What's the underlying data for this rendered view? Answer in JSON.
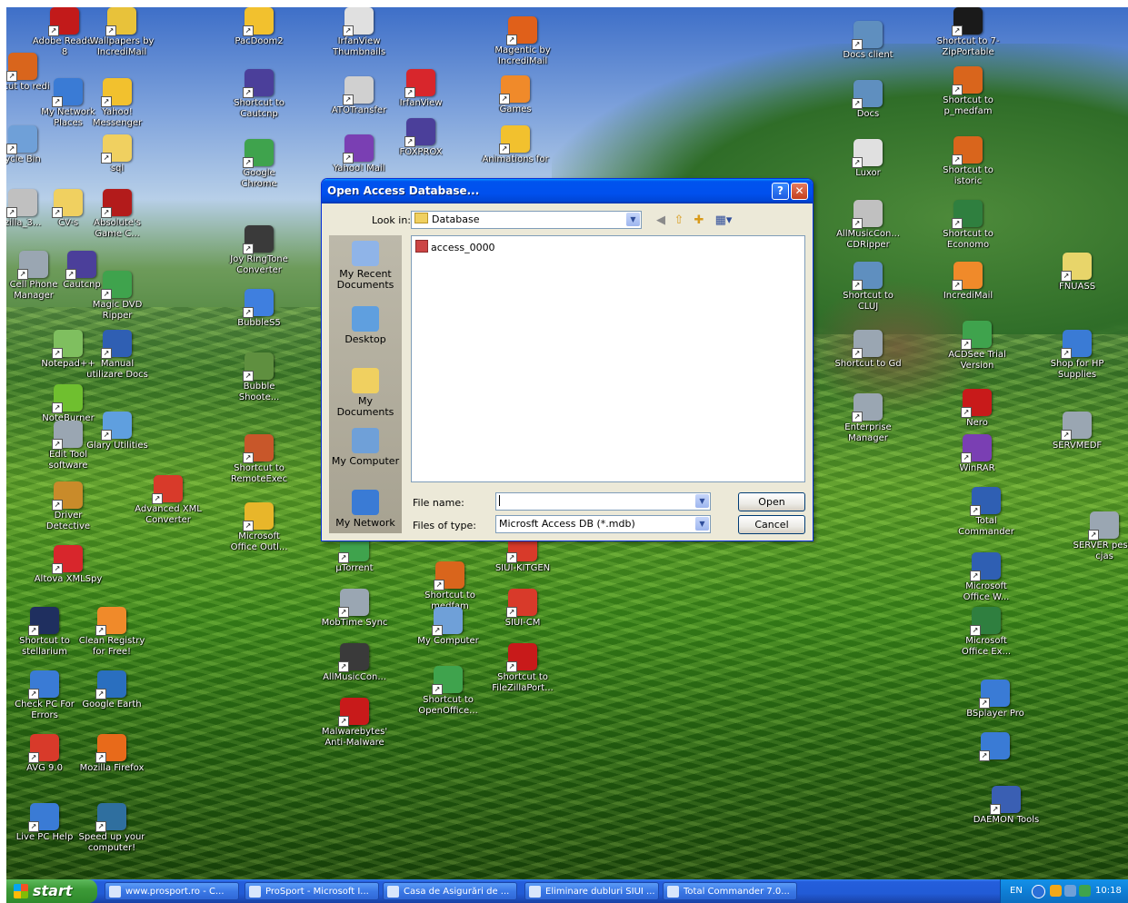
{
  "desktop": {
    "icons": [
      {
        "name": "adobe-reader-icon",
        "label": "Adobe Reader 8",
        "color": "#c21a1a"
      },
      {
        "name": "wallpapers-incredimail-icon",
        "label": "Wallpapers by IncrediMail",
        "color": "#e8c23a"
      },
      {
        "name": "shortcut-incredi-icon",
        "label": "rtcut to redi",
        "color": "#d9651c"
      },
      {
        "name": "my-network-places-icon",
        "label": "My Network Places",
        "color": "#3a7bd5"
      },
      {
        "name": "yahoo-messenger-icon",
        "label": "Yahoo! Messenger",
        "color": "#f2c12e"
      },
      {
        "name": "recycle-bin-icon",
        "label": "ycle Bin",
        "color": "#6fa0d8"
      },
      {
        "name": "sql-folder-icon",
        "label": "sql",
        "color": "#f0d060"
      },
      {
        "name": "zilla-icon",
        "label": "zilla_3...",
        "color": "#c0c0c0"
      },
      {
        "name": "cv-s-folder-icon",
        "label": "CV-s",
        "color": "#f0d060"
      },
      {
        "name": "absolute-games-icon",
        "label": "Absolute's Game C...",
        "color": "#b31b1b"
      },
      {
        "name": "cell-phone-manager-icon",
        "label": "Cell Phone Manager",
        "color": "#9aa6b2"
      },
      {
        "name": "cautcnp-icon",
        "label": "Cautcnp",
        "color": "#4b3f9a"
      },
      {
        "name": "magic-dvd-ripper-icon",
        "label": "Magic DVD Ripper",
        "color": "#3fa34d"
      },
      {
        "name": "notepad-plus-icon",
        "label": "Notepad++",
        "color": "#7fbf5f"
      },
      {
        "name": "manual-docs-icon",
        "label": "Manual utilizare Docs",
        "color": "#2f5fb3"
      },
      {
        "name": "noteburner-icon",
        "label": "NoteBurner",
        "color": "#6fbf2f"
      },
      {
        "name": "edit-tool-icon",
        "label": "Edit Tool software",
        "color": "#9aa6b2"
      },
      {
        "name": "glary-utilities-icon",
        "label": "Glary Utilities",
        "color": "#5f9fdf"
      },
      {
        "name": "driver-detective-icon",
        "label": "Driver Detective",
        "color": "#c98b2a"
      },
      {
        "name": "advanced-xml-icon",
        "label": "Advanced XML Converter",
        "color": "#d83a2a"
      },
      {
        "name": "altova-xmlspy-icon",
        "label": "Altova XMLSpy",
        "color": "#d8262c"
      },
      {
        "name": "stellarium-icon",
        "label": "Shortcut to stellarium",
        "color": "#1f2f5f"
      },
      {
        "name": "clean-registry-icon",
        "label": "Clean Registry for Free!",
        "color": "#f08a2a"
      },
      {
        "name": "check-pc-icon",
        "label": "Check PC For Errors",
        "color": "#3a7bd5"
      },
      {
        "name": "google-earth-icon",
        "label": "Google Earth",
        "color": "#2a6fbf"
      },
      {
        "name": "avg-icon",
        "label": "AVG 9.0",
        "color": "#d83a2a"
      },
      {
        "name": "firefox-icon",
        "label": "Mozilla Firefox",
        "color": "#e86a1a"
      },
      {
        "name": "live-pc-help-icon",
        "label": "Live PC Help",
        "color": "#3a7bd5"
      },
      {
        "name": "speed-up-icon",
        "label": "Speed up your computer!",
        "color": "#2f6f9f"
      },
      {
        "name": "pacdoom-icon",
        "label": "PacDoom2",
        "color": "#f2c12e"
      },
      {
        "name": "irfanview-thumbnails-icon",
        "label": "IrfanView Thumbnails",
        "color": "#e0e0e0"
      },
      {
        "name": "magentic-icon",
        "label": "Magentic by IncrediMail",
        "color": "#e0601a"
      },
      {
        "name": "cautcnp-shortcut-icon",
        "label": "Shortcut to Cautcnp",
        "color": "#4b3f9a"
      },
      {
        "name": "atotransfer-icon",
        "label": "ATOTransfer",
        "color": "#d0d0d0"
      },
      {
        "name": "irfanview-icon",
        "label": "IrfanView",
        "color": "#d8262c"
      },
      {
        "name": "games-icon",
        "label": "Games",
        "color": "#f08a2a"
      },
      {
        "name": "google-chrome-icon",
        "label": "Google Chrome",
        "color": "#3fa34d"
      },
      {
        "name": "yahoo-mail-icon",
        "label": "Yahoo! Mail",
        "color": "#7a3fb3"
      },
      {
        "name": "foxprox-icon",
        "label": "FOXPROX",
        "color": "#4b3f9a"
      },
      {
        "name": "animations-icon",
        "label": "Animations for",
        "color": "#f2c12e"
      },
      {
        "name": "joy-ringtone-icon",
        "label": "Joy RingTone Converter",
        "color": "#3a3a3a"
      },
      {
        "name": "bubbles5-icon",
        "label": "BubbleS5",
        "color": "#3f7fdf"
      },
      {
        "name": "bubble-shooter-icon",
        "label": "Bubble Shoote...",
        "color": "#5f8f3f"
      },
      {
        "name": "remoteexec-icon",
        "label": "Shortcut to RemoteExec",
        "color": "#c8572a"
      },
      {
        "name": "outlook-icon",
        "label": "Microsoft Office Outl...",
        "color": "#e8b62a"
      },
      {
        "name": "utorrent-icon",
        "label": "µTorrent",
        "color": "#3fa34d"
      },
      {
        "name": "siui-kitgen-icon",
        "label": "SIUI-KITGEN",
        "color": "#d83a2a"
      },
      {
        "name": "medfam-icon",
        "label": "Shortcut to medfam",
        "color": "#d9651c"
      },
      {
        "name": "mobtime-sync-icon",
        "label": "MobTime Sync",
        "color": "#9aa6b2"
      },
      {
        "name": "siui-cm-icon",
        "label": "SIUI-CM",
        "color": "#d83a2a"
      },
      {
        "name": "my-computer-desktop-icon",
        "label": "My Computer",
        "color": "#6fa0d8"
      },
      {
        "name": "allmusic-icon",
        "label": "AllMusicCon...",
        "color": "#3a3a3a"
      },
      {
        "name": "filezilla-icon",
        "label": "Shortcut to FileZillaPort...",
        "color": "#c81a1a"
      },
      {
        "name": "openoffice-icon",
        "label": "Shortcut to OpenOffice...",
        "color": "#3fa34d"
      },
      {
        "name": "malwarebytes-icon",
        "label": "Malwarebytes' Anti-Malware",
        "color": "#c81a1a"
      },
      {
        "name": "docs-client-icon",
        "label": "Docs client",
        "color": "#5f8fbf"
      },
      {
        "name": "7zip-icon",
        "label": "Shortcut to 7-ZipPortable",
        "color": "#1a1a1a"
      },
      {
        "name": "p-medfam-icon",
        "label": "Shortcut to p_medfam",
        "color": "#d9651c"
      },
      {
        "name": "docs-icon",
        "label": "Docs",
        "color": "#5f8fbf"
      },
      {
        "name": "istoric-icon",
        "label": "Shortcut to istoric",
        "color": "#d9651c"
      },
      {
        "name": "luxor-icon",
        "label": "Luxor",
        "color": "#e0e0e0"
      },
      {
        "name": "cdripper-icon",
        "label": "AllMusicCon... CDRipper",
        "color": "#c0c0c0"
      },
      {
        "name": "economo-icon",
        "label": "Shortcut to Economo",
        "color": "#2f7f3f"
      },
      {
        "name": "cluj-icon",
        "label": "Shortcut to CLUJ",
        "color": "#5f8fbf"
      },
      {
        "name": "incredimail-icon",
        "label": "IncrediMail",
        "color": "#f08a2a"
      },
      {
        "name": "fnuass-icon",
        "label": "FNUASS",
        "color": "#e8d56a"
      },
      {
        "name": "gd-icon",
        "label": "Shortcut to Gd",
        "color": "#9aa6b2"
      },
      {
        "name": "acdsee-icon",
        "label": "ACDSee Trial Version",
        "color": "#3fa34d"
      },
      {
        "name": "hp-supplies-icon",
        "label": "Shop for HP Supplies",
        "color": "#3a7bd5"
      },
      {
        "name": "enterprise-manager-icon",
        "label": "Enterprise Manager",
        "color": "#9aa6b2"
      },
      {
        "name": "nero-icon",
        "label": "Nero",
        "color": "#c81a1a"
      },
      {
        "name": "servmedf-icon",
        "label": "SERVMEDF",
        "color": "#9aa6b2"
      },
      {
        "name": "winrar-icon",
        "label": "WinRAR",
        "color": "#7a3fb3"
      },
      {
        "name": "total-commander-icon",
        "label": "Total Commander",
        "color": "#2f5fb3"
      },
      {
        "name": "server-icon",
        "label": "SERVER pess-cjas",
        "color": "#9aa6b2"
      },
      {
        "name": "word-icon",
        "label": "Microsoft Office W...",
        "color": "#2f5fb3"
      },
      {
        "name": "excel-icon",
        "label": "Microsoft Office Ex...",
        "color": "#2f7f3f"
      },
      {
        "name": "bsplayer-icon",
        "label": "BSplayer Pro",
        "color": "#3a7bd5"
      },
      {
        "name": "ie-icon",
        "label": "",
        "color": "#3a7bd5"
      },
      {
        "name": "daemon-tools-icon",
        "label": "DAEMON Tools",
        "color": "#3a5fb3"
      }
    ]
  },
  "dialog": {
    "title": "Open Access Database...",
    "help": "?",
    "close": "✕",
    "look_in_label": "Look in:",
    "look_in_value": "Database",
    "places": [
      {
        "name": "my-recent-documents",
        "label": "My Recent Documents",
        "color": "#8fb4e8"
      },
      {
        "name": "desktop",
        "label": "Desktop",
        "color": "#5f9fdf"
      },
      {
        "name": "my-documents",
        "label": "My Documents",
        "color": "#f0d060"
      },
      {
        "name": "my-computer",
        "label": "My Computer",
        "color": "#6fa0d8"
      },
      {
        "name": "my-network",
        "label": "My Network",
        "color": "#3a7bd5"
      }
    ],
    "files": [
      "access_0000"
    ],
    "file_name_label": "File name:",
    "file_name_value": "",
    "files_of_type_label": "Files of type:",
    "files_of_type_value": "Microsft Access DB (*.mdb)",
    "open_label": "Open",
    "cancel_label": "Cancel"
  },
  "taskbar": {
    "start": "start",
    "tasks": [
      "www.prosport.ro - C...",
      "ProSport - Microsoft I...",
      "Casa de Asigurări de ...",
      "Eliminare dubluri SIUI ...",
      "Total Commander 7.0..."
    ],
    "language": "EN",
    "clock": "10:18"
  },
  "colors": {
    "titlebar": "#0054e3",
    "taskbar": "#245edc",
    "start": "#3d9a38",
    "dialog_bg": "#ece9d8"
  }
}
